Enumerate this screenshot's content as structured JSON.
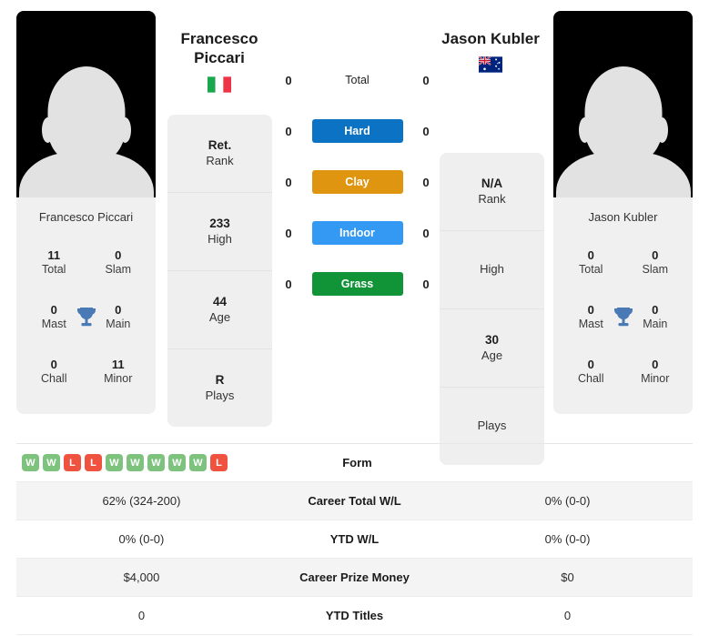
{
  "players": {
    "left": {
      "name_line1": "Francesco",
      "name_line2": "Piccari",
      "full_name": "Francesco Piccari",
      "flag": "italy-flag",
      "rank": "Ret.",
      "rank_label": "Rank",
      "high": "233",
      "high_label": "High",
      "age": "44",
      "age_label": "Age",
      "plays": "R",
      "plays_label": "Plays",
      "titles": {
        "total": "11",
        "total_label": "Total",
        "slam": "0",
        "slam_label": "Slam",
        "mast": "0",
        "mast_label": "Mast",
        "main": "0",
        "main_label": "Main",
        "chall": "0",
        "chall_label": "Chall",
        "minor": "11",
        "minor_label": "Minor"
      }
    },
    "right": {
      "name_line1": "Jason Kubler",
      "name_line2": "",
      "full_name": "Jason Kubler",
      "flag": "australia-flag",
      "rank": "N/A",
      "rank_label": "Rank",
      "high": "",
      "high_label": "High",
      "age": "30",
      "age_label": "Age",
      "plays": "",
      "plays_label": "Plays",
      "titles": {
        "total": "0",
        "total_label": "Total",
        "slam": "0",
        "slam_label": "Slam",
        "mast": "0",
        "mast_label": "Mast",
        "main": "0",
        "main_label": "Main",
        "chall": "0",
        "chall_label": "Chall",
        "minor": "0",
        "minor_label": "Minor"
      }
    }
  },
  "head_to_head": [
    {
      "label": "Total",
      "left": "0",
      "right": "0",
      "color": "",
      "style": "plain"
    },
    {
      "label": "Hard",
      "left": "0",
      "right": "0",
      "color": "#0b72c4",
      "style": "badge"
    },
    {
      "label": "Clay",
      "left": "0",
      "right": "0",
      "color": "#e09510",
      "style": "badge"
    },
    {
      "label": "Indoor",
      "left": "0",
      "right": "0",
      "color": "#3399f3",
      "style": "badge"
    },
    {
      "label": "Grass",
      "left": "0",
      "right": "0",
      "color": "#109437",
      "style": "badge"
    }
  ],
  "form": {
    "label": "Form",
    "left_results": [
      "W",
      "W",
      "L",
      "L",
      "W",
      "W",
      "W",
      "W",
      "W",
      "L"
    ],
    "right_results": []
  },
  "stats_rows": [
    {
      "label": "Career Total W/L",
      "left": "62% (324-200)",
      "right": "0% (0-0)"
    },
    {
      "label": "YTD W/L",
      "left": "0% (0-0)",
      "right": "0% (0-0)"
    },
    {
      "label": "Career Prize Money",
      "left": "$4,000",
      "right": "$0"
    },
    {
      "label": "YTD Titles",
      "left": "0",
      "right": "0"
    }
  ],
  "colors": {
    "hard": "#0b72c4",
    "clay": "#e09510",
    "indoor": "#3399f3",
    "grass": "#109437",
    "win": "#7dc37e",
    "loss": "#ef5340",
    "trophy": "#4a7ab5",
    "card_bg": "#efefef"
  }
}
